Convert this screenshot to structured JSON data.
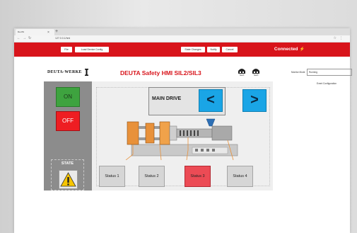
{
  "browser": {
    "tab_title": "DeuTA",
    "url": "127.0.0.1/hmi"
  },
  "appbar": {
    "buttons_left": [
      "File",
      "Load Device Config"
    ],
    "buttons_mid": [
      "State Changes",
      "Notify",
      "Cancel"
    ],
    "connected": "Connected"
  },
  "hmi": {
    "logo": "DEUTA-WERKE",
    "title": "DEUTA Safety HMI SIL2/SIL3",
    "robot_labels": [
      "Teach",
      "Teach"
    ],
    "on_label": "ON",
    "off_label": "OFF",
    "state_label": "STATE",
    "main_drive_label": "MAIN DRIVE",
    "status_labels": [
      "Status 1",
      "Status 2",
      "Status 3",
      "Status 4"
    ]
  },
  "config": {
    "mode_label": "Monitor Mode",
    "mode_value": "Running",
    "event_config": "Event Configuration"
  },
  "colors": {
    "brand_red": "#d8141b",
    "on_green": "#3ea33f",
    "off_red": "#ee1d22",
    "arrow_blue": "#1aa5e6",
    "alert_status": "#ec4b55"
  },
  "icons": [
    "warning-icon",
    "left-arrow-icon",
    "right-arrow-icon",
    "robot-icon",
    "plug-icon"
  ]
}
